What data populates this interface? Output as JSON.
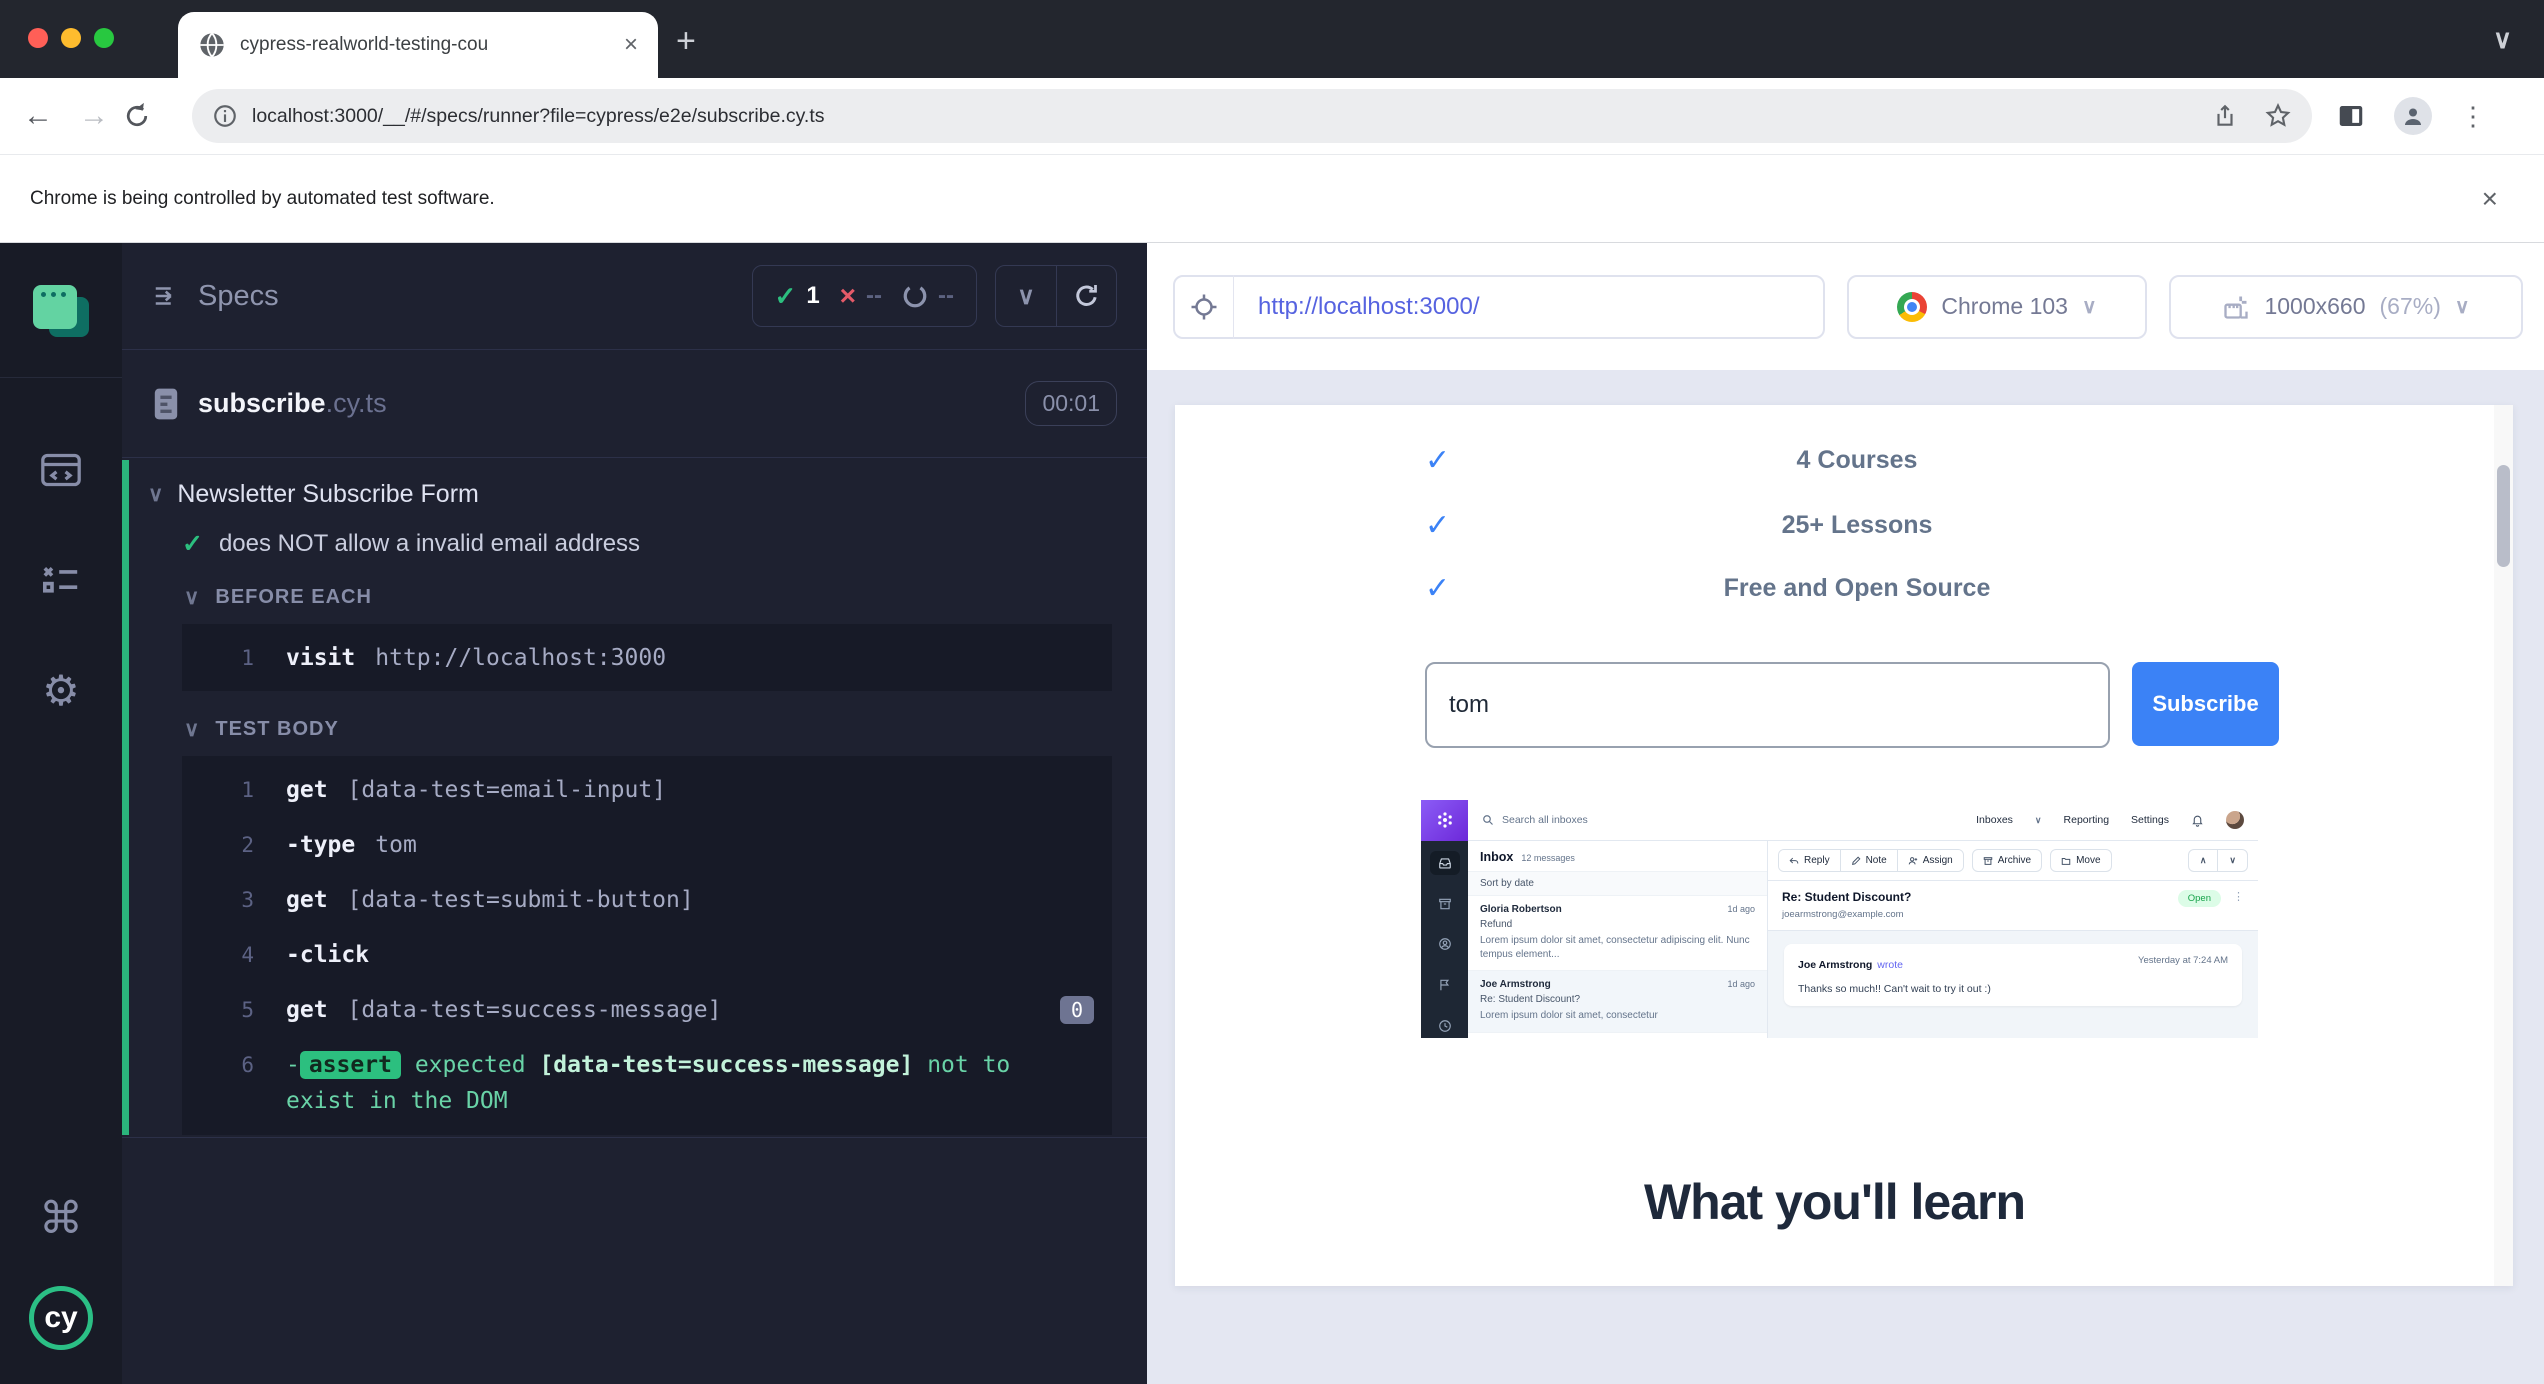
{
  "icons": {
    "plus": "+",
    "close": "×",
    "chevron_down": "∨",
    "chevron_up": "∧",
    "back": "←",
    "forward": "→",
    "menu_dots": "⋮",
    "gear": "⚙",
    "command": "⌘",
    "check": "✓",
    "cross": "×",
    "dashes": "--",
    "tree_chevron": "∨",
    "dash": "-"
  },
  "browser": {
    "tab_title": "cypress-realworld-testing-cou",
    "url": "localhost:3000/__/#/specs/runner?file=cypress/e2e/subscribe.cy.ts",
    "banner": "Chrome is being controlled by automated test software."
  },
  "cypress": {
    "logo_text": "cy"
  },
  "reporter": {
    "title": "Specs",
    "stats": {
      "passed": "1",
      "failed": "--",
      "pending": "--"
    },
    "spec": {
      "name": "subscribe",
      "ext": ".cy.ts",
      "duration": "00:01"
    },
    "suite": "Newsletter Subscribe Form",
    "test": "does NOT allow a invalid email address",
    "before_each": {
      "label": "BEFORE EACH",
      "commands": [
        {
          "n": "1",
          "name": "visit",
          "args": "http://localhost:3000"
        }
      ]
    },
    "test_body": {
      "label": "TEST BODY",
      "commands": [
        {
          "n": "1",
          "name": "get",
          "args": "[data-test=email-input]"
        },
        {
          "n": "2",
          "name": "-type",
          "args": "tom"
        },
        {
          "n": "3",
          "name": "get",
          "args": "[data-test=submit-button]"
        },
        {
          "n": "4",
          "name": "-click",
          "args": ""
        },
        {
          "n": "5",
          "name": "get",
          "args": "[data-test=success-message]",
          "badge": "0"
        }
      ],
      "assert": {
        "n": "6",
        "dash": "-",
        "pill": "assert",
        "pre": "expected",
        "target": "[data-test=success-message]",
        "post": "not to exist in the DOM"
      }
    }
  },
  "aut": {
    "url": "http://localhost:3000/",
    "browser_select": "Chrome 103",
    "viewport": "1000x660",
    "zoom": "(67%)",
    "app": {
      "features": [
        "4 Courses",
        "25+ Lessons",
        "Free and Open Source"
      ],
      "email_value": "tom",
      "subscribe_label": "Subscribe",
      "heading": "What you'll learn"
    },
    "screenshot": {
      "search_placeholder": "Search all inboxes",
      "nav": [
        "Inboxes",
        "Reporting",
        "Settings"
      ],
      "inbox_title": "Inbox",
      "inbox_count": "12 messages",
      "sort_label": "Sort by date",
      "messages": [
        {
          "from": "Gloria Robertson",
          "time": "1d ago",
          "subject": "Refund",
          "preview": "Lorem ipsum dolor sit amet, consectetur adipiscing elit. Nunc tempus element..."
        },
        {
          "from": "Joe Armstrong",
          "time": "1d ago",
          "subject": "Re: Student Discount?",
          "preview": "Lorem ipsum dolor sit amet, consectetur"
        }
      ],
      "toolbar": {
        "reply": "Reply",
        "note": "Note",
        "assign": "Assign",
        "archive": "Archive",
        "move": "Move"
      },
      "thread": {
        "subject": "Re: Student Discount?",
        "email": "joearmstrong@example.com",
        "status": "Open",
        "author": "Joe Armstrong",
        "wrote": "wrote",
        "time": "Yesterday at 7:24 AM",
        "body": "Thanks so much!! Can't wait to try it out :)"
      }
    }
  }
}
